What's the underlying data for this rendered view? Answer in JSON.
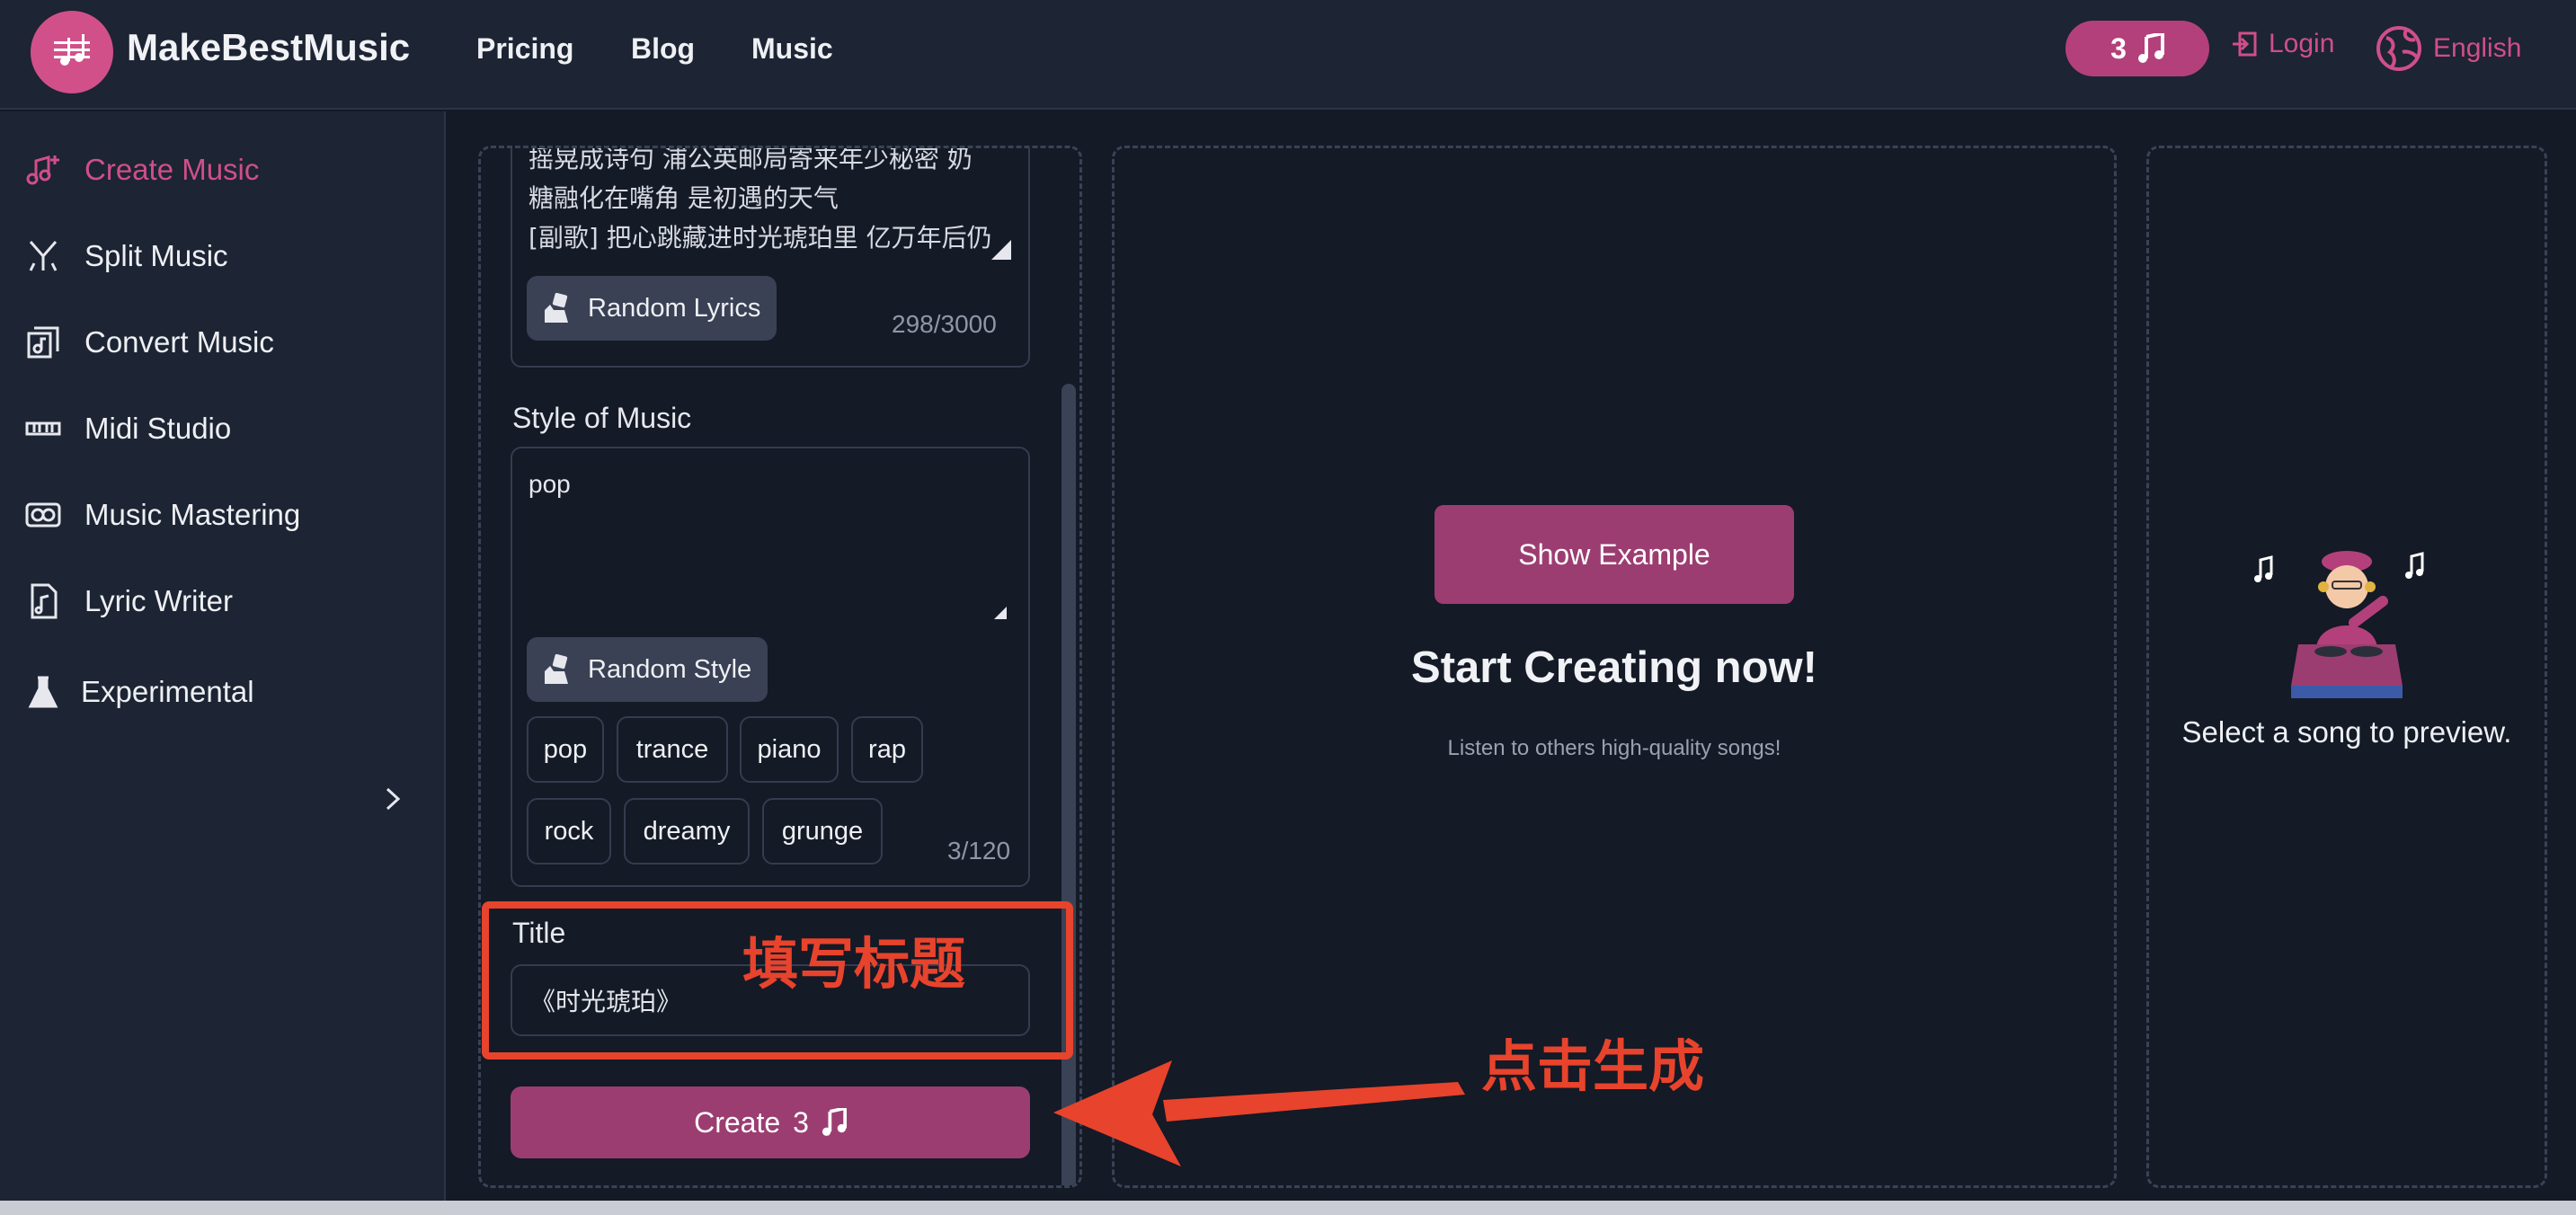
{
  "header": {
    "brand": "MakeBestMusic",
    "nav": [
      "Pricing",
      "Blog",
      "Music"
    ],
    "credits": "3",
    "login": "Login",
    "language": "English"
  },
  "sidebar": {
    "items": [
      {
        "label": "Create Music",
        "icon": "music-plus-icon",
        "active": true
      },
      {
        "label": "Split Music",
        "icon": "split-icon"
      },
      {
        "label": "Convert Music",
        "icon": "convert-icon"
      },
      {
        "label": "Midi Studio",
        "icon": "midi-icon"
      },
      {
        "label": "Music Mastering",
        "icon": "mastering-icon"
      },
      {
        "label": "Lyric Writer",
        "icon": "lyric-icon"
      },
      {
        "label": "Experimental",
        "icon": "flask-icon"
      }
    ]
  },
  "form": {
    "lyrics_text": "摇晃成诗句 浦公英邮局寄来年少秘密 奶\n糖融化在嘴角 是初遇的天气\n[副歌] 把心跳藏进时光琥珀里 亿万年后仍\n闪烁相遇轨迹 你睫毛垂落的星轨太拥挤",
    "random_lyrics": "Random Lyrics",
    "lyrics_count": "298/3000",
    "style_label": "Style of Music",
    "style_value": "pop",
    "random_style": "Random Style",
    "style_tags": [
      "pop",
      "trance",
      "piano",
      "rap",
      "rock",
      "dreamy",
      "grunge"
    ],
    "style_count": "3/120",
    "title_label": "Title",
    "title_value": "《时光琥珀》",
    "create_label": "Create",
    "create_cost": "3"
  },
  "middle": {
    "show_example": "Show Example",
    "heading": "Start Creating now!",
    "subtext": "Listen to others high-quality songs!"
  },
  "right": {
    "preview_text": "Select a song to preview."
  },
  "annotations": {
    "title_note": "填写标题",
    "create_note": "点击生成"
  },
  "colors": {
    "accent": "#cf4f8a",
    "button": "#9c3d72",
    "annotation": "#e8432c"
  }
}
